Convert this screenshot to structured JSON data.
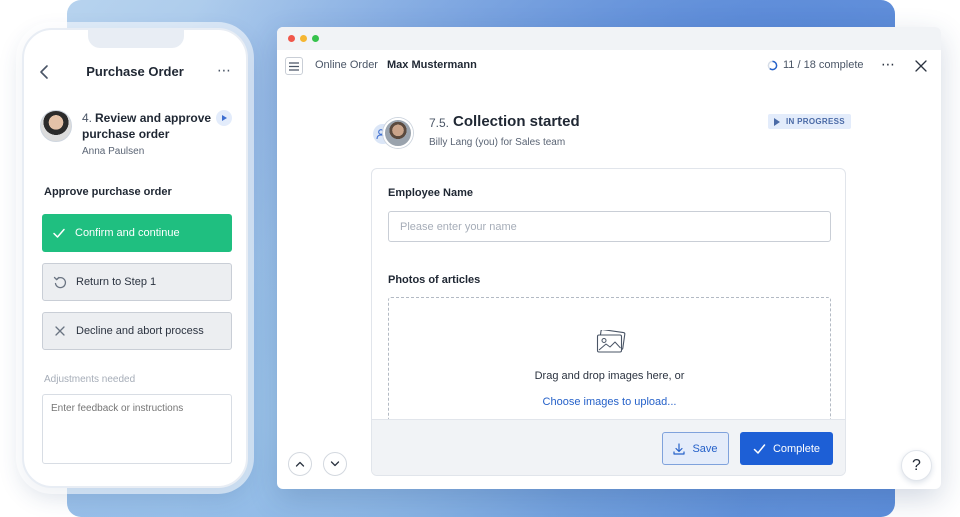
{
  "mobile": {
    "title": "Purchase Order",
    "more_icon": "⋯",
    "task": {
      "number": "4.",
      "title": "Review and approve purchase order",
      "assignee": "Anna Paulsen"
    },
    "section_title": "Approve purchase order",
    "actions": {
      "confirm": "Confirm and continue",
      "return": "Return to Step 1",
      "decline": "Decline and abort process"
    },
    "adjustments_label": "Adjustments needed",
    "feedback_placeholder": "Enter feedback or instructions"
  },
  "window": {
    "breadcrumb": {
      "section": "Online Order",
      "current": "Max Mustermann"
    },
    "progress_text": "11 / 18 complete",
    "progress": {
      "completed": 11,
      "total": 18
    },
    "more_icon": "⋯",
    "step": {
      "number": "7.5.",
      "title": "Collection started",
      "subtitle": "Billy Lang (you) for Sales team",
      "status": "IN PROGRESS"
    },
    "form": {
      "employee_label": "Employee Name",
      "employee_placeholder": "Please enter your name",
      "photos_label": "Photos of articles",
      "drop_text": "Drag and drop images here, or",
      "upload_link": "Choose images to upload..."
    },
    "buttons": {
      "save": "Save",
      "complete": "Complete"
    }
  },
  "help_label": "?",
  "colors": {
    "primary_green": "#1fbf80",
    "primary_blue": "#1d5fd6",
    "link_blue": "#2561c9",
    "badge_bg": "#e3ecfb"
  },
  "icons": [
    "chevron-left-icon",
    "more-icon",
    "play-icon",
    "check-icon",
    "undo-icon",
    "close-icon",
    "menu-icon",
    "progress-ring-icon",
    "team-icon",
    "image-icon",
    "download-icon",
    "chevron-up-icon",
    "chevron-down-icon",
    "help-icon"
  ]
}
